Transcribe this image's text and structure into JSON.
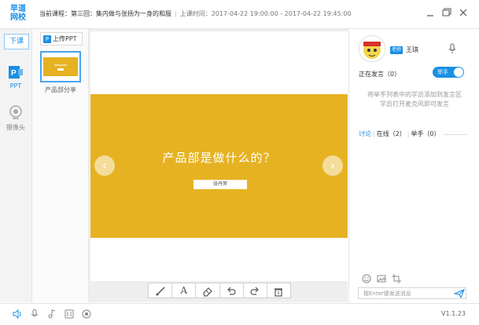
{
  "header": {
    "logo_line1": "早道",
    "logo_line2": "网校",
    "course_label": "当前课程：第三回：集内做与张扬为一身的和服",
    "class_time_label": "上课时间：2017-04-22 19:00:00 - 2017-04-22 19:45:00"
  },
  "rail": {
    "end_class_label": "下课",
    "ppt_label": "PPT",
    "camera_label": "摄像头",
    "icons": [
      "ppt-icon",
      "camera-icon"
    ]
  },
  "thumbnails": {
    "upload_label": "上传PPT",
    "upload_icon_text": "P",
    "items": [
      {
        "label": "产品部分享"
      }
    ]
  },
  "slide": {
    "title": "产品部是做什么的？",
    "presenter": "张丹萍",
    "band_color": "#e6b222",
    "prev_glyph": "‹",
    "next_glyph": "›"
  },
  "toolbar": {
    "tools": [
      "brush-icon",
      "text-icon",
      "eraser-icon",
      "undo-icon",
      "redo-icon",
      "clear-icon"
    ],
    "text_tool_glyph": "A"
  },
  "panel": {
    "teacher_badge": "老师",
    "teacher_name": "王琪",
    "speaking_label": "正在发言（0）",
    "raise_hand_toggle": "举手",
    "hint_line1": "将举手列表中的学员添加到发言区",
    "hint_line2": "学员打开麦克风即可发言",
    "tab_discuss": "讨论",
    "tab_online": "在线（2）",
    "tab_raise": "举手（0）",
    "input_placeholder": "按Enter键发送消息"
  },
  "bottom": {
    "version": "V1.1.23"
  },
  "accent_color": "#1a8fe3"
}
